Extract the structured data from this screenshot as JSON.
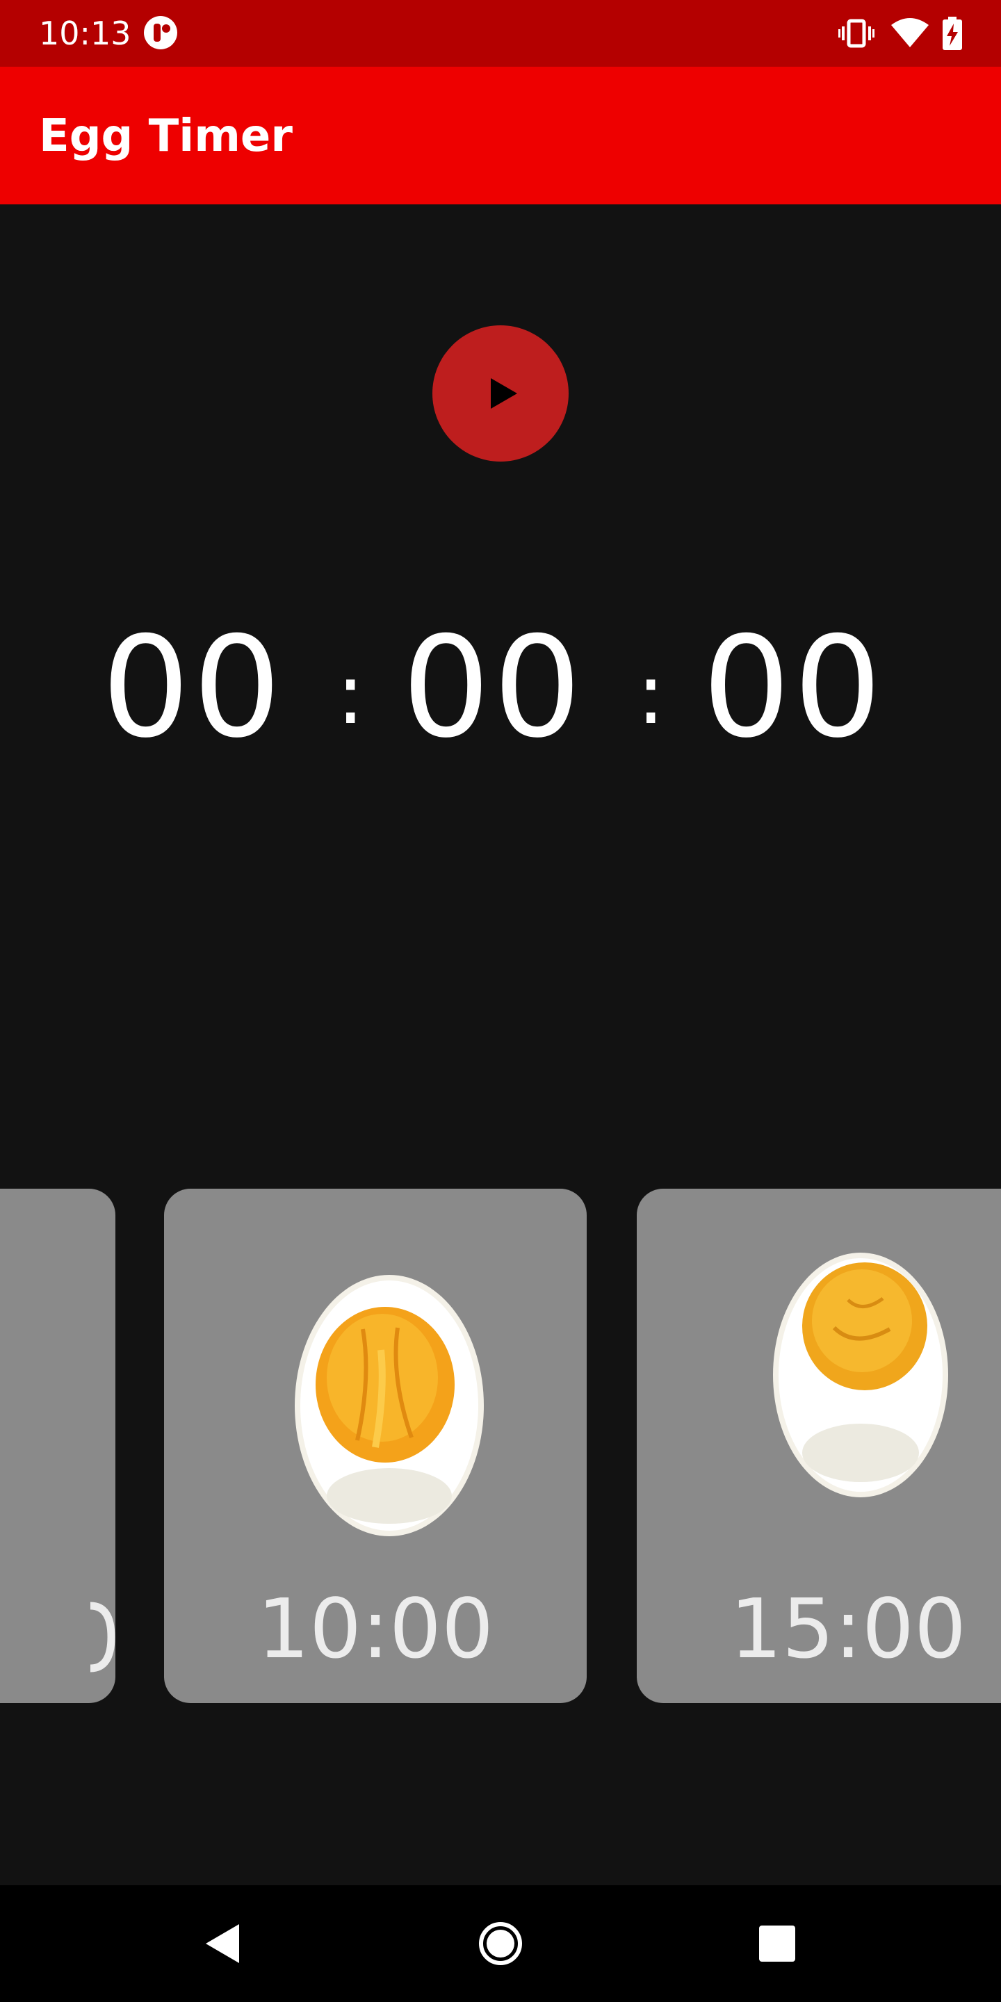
{
  "status_bar": {
    "time": "10:13",
    "icons": [
      "app-notification-icon",
      "vibrate-icon",
      "wifi-icon",
      "battery-charging-icon"
    ]
  },
  "app_bar": {
    "title": "Egg Timer"
  },
  "player": {
    "icon": "play-icon"
  },
  "timer": {
    "hours": "00",
    "minutes": "00",
    "seconds": "00",
    "separator": ":"
  },
  "egg_cards": [
    {
      "time": "",
      "image": "egg-image"
    },
    {
      "time": "10:00",
      "image": "soft-boiled-egg-image"
    },
    {
      "time": "15:00",
      "image": "hard-boiled-egg-image"
    }
  ],
  "nav_bar": {
    "icons": [
      "back-icon",
      "home-icon",
      "recents-icon"
    ]
  },
  "colors": {
    "status_bar": "#b40000",
    "app_bar": "#ee0000",
    "background": "#121212",
    "play_button": "#be1e1e",
    "card": "#8a8a8a"
  }
}
